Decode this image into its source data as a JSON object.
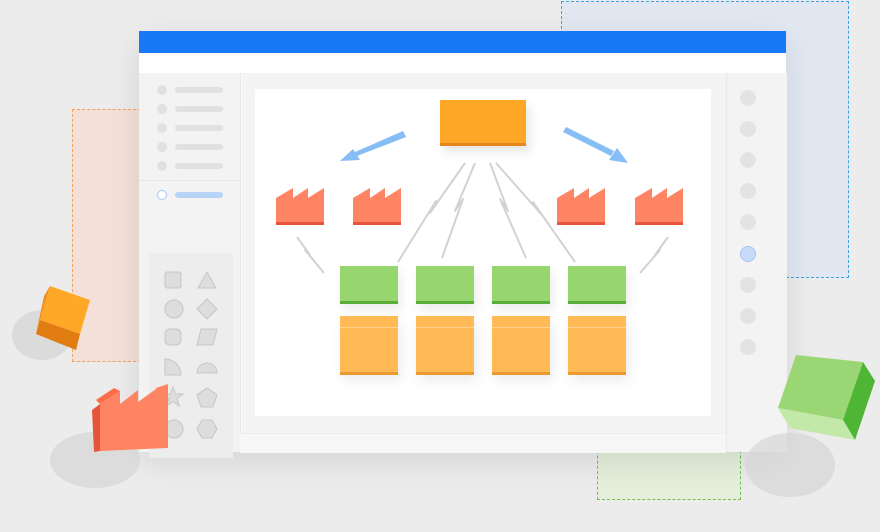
{
  "app": {
    "accent_color": "#1779f5",
    "left_panel": {
      "menu_items": [
        {
          "icon": "circle-bullet-icon",
          "state": "normal"
        },
        {
          "icon": "circle-bullet-icon",
          "state": "normal"
        },
        {
          "icon": "circle-bullet-icon",
          "state": "normal"
        },
        {
          "icon": "circle-bullet-icon",
          "state": "normal"
        },
        {
          "icon": "circle-bullet-icon",
          "state": "normal"
        },
        {
          "icon": "circle-bullet-icon",
          "state": "selected"
        }
      ],
      "shape_library": [
        "square-icon",
        "triangle-icon",
        "circle-icon",
        "diamond-icon",
        "rounded-square-icon",
        "parallelogram-icon",
        "quarter-circle-icon",
        "half-circle-icon",
        "star-icon",
        "pentagon-icon",
        "ring-icon",
        "hexagon-icon"
      ]
    },
    "right_panel": {
      "nav_dots": 9,
      "selected_index": 5
    },
    "diagram": {
      "colors": {
        "root": "#ffa726",
        "factory": "#ff8463",
        "team": "#97d56f",
        "detail": "#ffb955",
        "arrow": "#86bdf4"
      },
      "nodes": {
        "root": "root-node",
        "factories": [
          "factory-icon",
          "factory-icon",
          "factory-icon",
          "factory-icon"
        ],
        "teams": [
          "green-node",
          "green-node",
          "green-node",
          "green-node"
        ],
        "details": [
          "orange-node",
          "orange-node",
          "orange-node",
          "orange-node"
        ]
      }
    }
  }
}
